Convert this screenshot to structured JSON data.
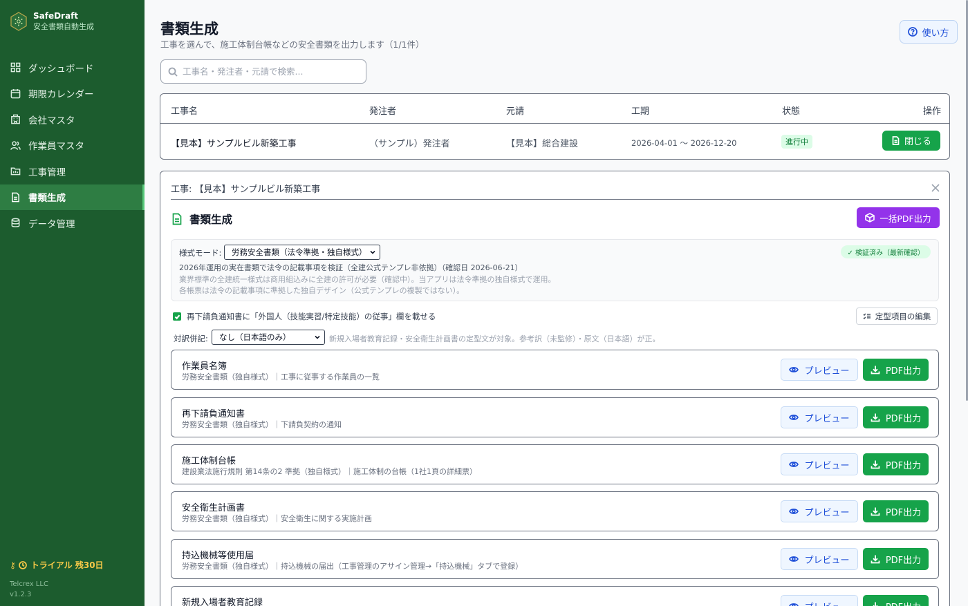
{
  "brand": {
    "name": "SafeDraft",
    "subtitle": "安全書類自動生成"
  },
  "sidebar": {
    "items": [
      {
        "label": "ダッシュボード",
        "icon": "dashboard-grid-icon"
      },
      {
        "label": "期限カレンダー",
        "icon": "calendar-icon"
      },
      {
        "label": "会社マスタ",
        "icon": "building-icon"
      },
      {
        "label": "作業員マスタ",
        "icon": "users-icon"
      },
      {
        "label": "工事管理",
        "icon": "construction-folder-icon"
      },
      {
        "label": "書類生成",
        "icon": "document-icon",
        "active": true
      },
      {
        "label": "データ管理",
        "icon": "database-icon"
      }
    ],
    "trial": "トライアル 残30日",
    "company": "Telcrex LLC",
    "version": "v1.2.3"
  },
  "header": {
    "title": "書類生成",
    "subtitle": "工事を選んで、施工体制台帳などの安全書類を出力します（1/1件）",
    "help_label": "使い方"
  },
  "search": {
    "placeholder": "工事名・発注者・元請で検索..."
  },
  "table": {
    "headers": [
      "工事名",
      "発注者",
      "元請",
      "工期",
      "状態",
      "操作"
    ],
    "rows": [
      {
        "name": "【見本】サンプルビル新築工事",
        "client": "（サンプル）発注者",
        "contractor": "【見本】総合建設",
        "period": "2026-04-01 〜 2026-12-20",
        "status": "進行中",
        "action": "閉じる"
      }
    ]
  },
  "panel": {
    "project_label": "工事: 【見本】サンプルビル新築工事",
    "section_title": "書類生成",
    "bulk_label": "一括PDF出力",
    "mode_label": "様式モード:",
    "mode_value": "労務安全書類（法令準拠・独自様式）",
    "verified": "✓ 検証済み（最新確認）",
    "mode_line1": "2026年運用の実在書類で法令の記載事項を検証（全建公式テンプレ非依拠）（確認日 2026-06-21）",
    "mode_line2": "業界標準の全建統一様式は商用組込みに全建の許可が必要（確認中）。当アプリは法令準拠の独自様式で運用。",
    "mode_line3": "各帳票は法令の記載事項に準拠した独自デザイン（公式テンプレの複製ではない）。",
    "checkbox_label": "再下請負通知書に「外国人（技能実習/特定技能）の従事」欄を載せる",
    "fixed_edit_label": "定型項目の編集",
    "translation_label": "対訳併記:",
    "translation_value": "なし（日本語のみ）",
    "translation_note": "新規入場者教育記録・安全衛生計画書の定型文が対象。参考訳（未監修）・原文（日本語）が正。",
    "preview_label": "プレビュー",
    "pdf_label": "PDF出力",
    "docs": [
      {
        "name": "作業員名簿",
        "desc": "労務安全書類（独自様式）｜工事に従事する作業員の一覧"
      },
      {
        "name": "再下請負通知書",
        "desc": "労務安全書類（独自様式）｜下請負契約の通知"
      },
      {
        "name": "施工体制台帳",
        "desc": "建設業法施行規則 第14条の2 準拠（独自様式）｜施工体制の台帳（1社1頁の詳細票）"
      },
      {
        "name": "安全衛生計画書",
        "desc": "労務安全書類（独自様式）｜安全衛生に関する実施計画"
      },
      {
        "name": "持込機械等使用届",
        "desc": "労務安全書類（独自様式）｜持込機械の届出（工事管理のアサイン管理→「持込機械」タブで登録）"
      },
      {
        "name": "新規入場者教育記録",
        "desc": ""
      }
    ]
  },
  "colors": {
    "sidebar": "#1c5c2e",
    "accent_green": "#16a34a",
    "purple": "#9333ea",
    "blue": "#1d4ed8"
  }
}
